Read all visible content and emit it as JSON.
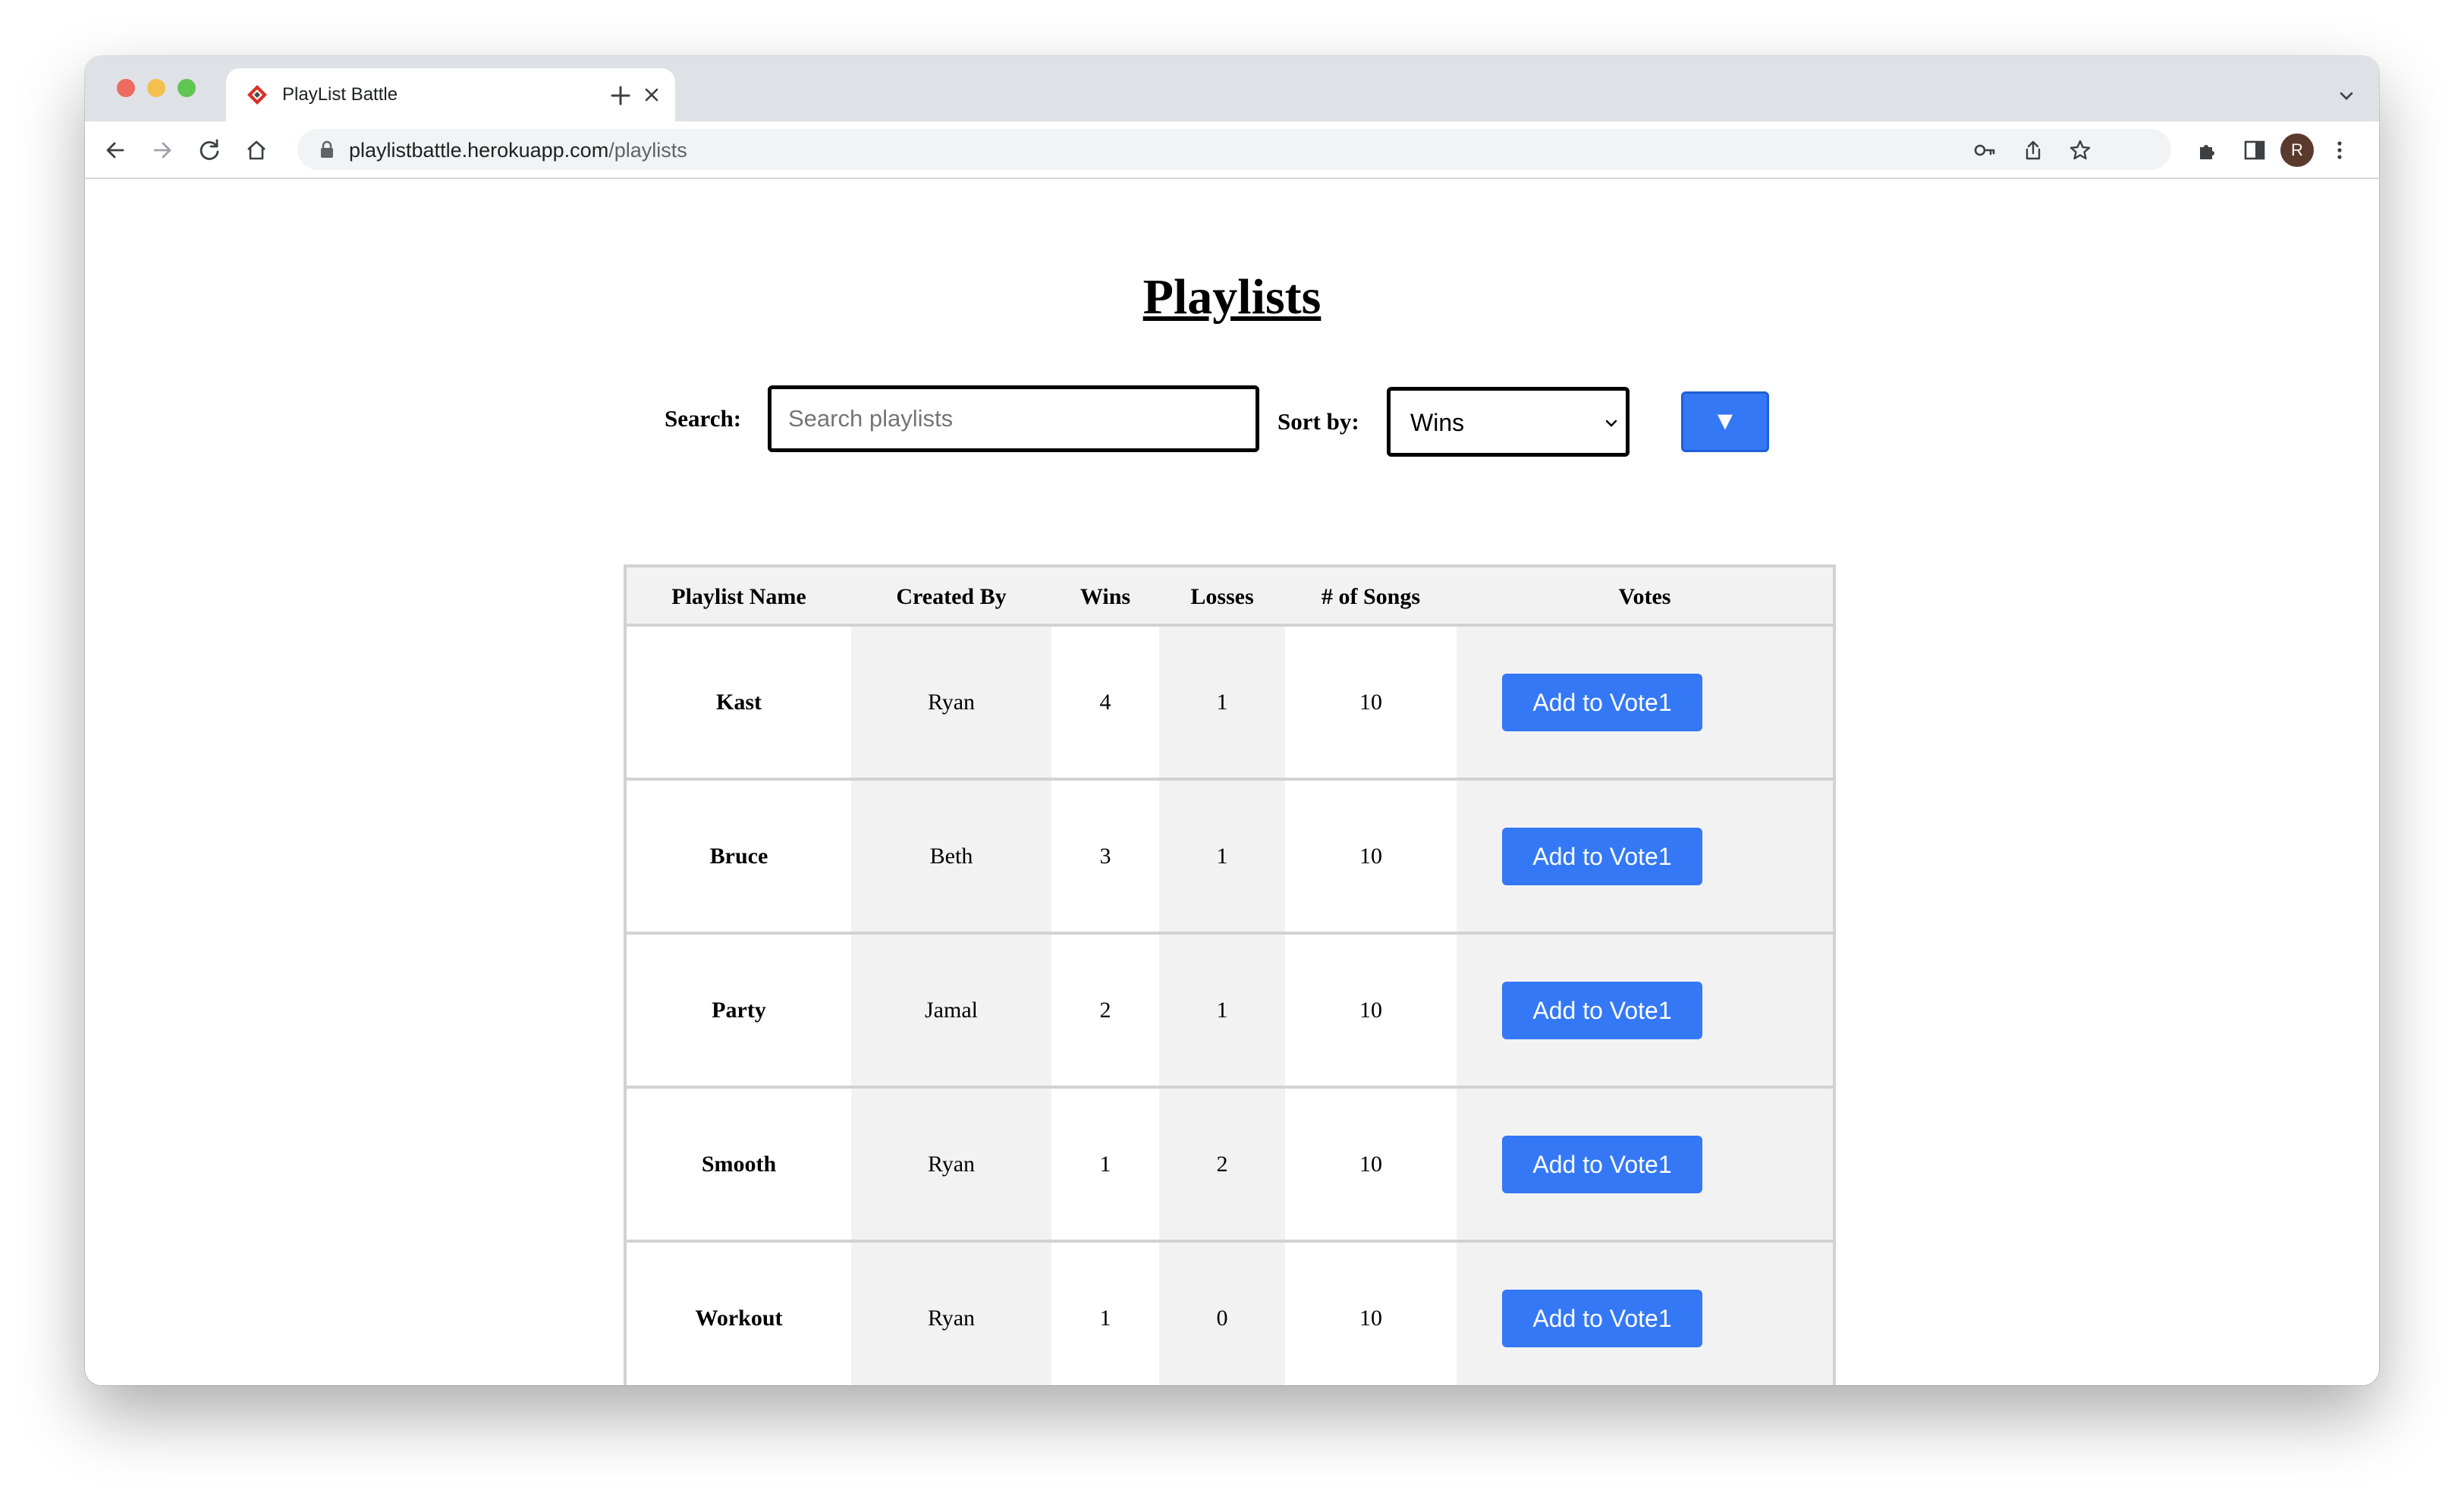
{
  "browser": {
    "tab_title": "PlayList Battle",
    "url_host": "playlistbattle.herokuapp.com",
    "url_path": "/playlists",
    "avatar_initial": "R"
  },
  "page": {
    "title": "Playlists",
    "search_label": "Search:",
    "search_placeholder": "Search playlists",
    "sort_label": "Sort by:",
    "sort_value": "Wins",
    "sort_direction_symbol": "▼"
  },
  "table": {
    "headers": [
      "Playlist Name",
      "Created By",
      "Wins",
      "Losses",
      "# of Songs",
      "Votes"
    ],
    "rows": [
      {
        "name": "Kast",
        "created_by": "Ryan",
        "wins": "4",
        "losses": "1",
        "songs": "10",
        "vote_label": "Add to Vote1"
      },
      {
        "name": "Bruce",
        "created_by": "Beth",
        "wins": "3",
        "losses": "1",
        "songs": "10",
        "vote_label": "Add to Vote1"
      },
      {
        "name": "Party",
        "created_by": "Jamal",
        "wins": "2",
        "losses": "1",
        "songs": "10",
        "vote_label": "Add to Vote1"
      },
      {
        "name": "Smooth",
        "created_by": "Ryan",
        "wins": "1",
        "losses": "2",
        "songs": "10",
        "vote_label": "Add to Vote1"
      },
      {
        "name": "Workout",
        "created_by": "Ryan",
        "wins": "1",
        "losses": "0",
        "songs": "10",
        "vote_label": "Add to Vote1"
      }
    ]
  },
  "colors": {
    "accent_button": "#3478f6",
    "shaded_column": "#f2f2f2",
    "border": "#d2d2d2"
  }
}
